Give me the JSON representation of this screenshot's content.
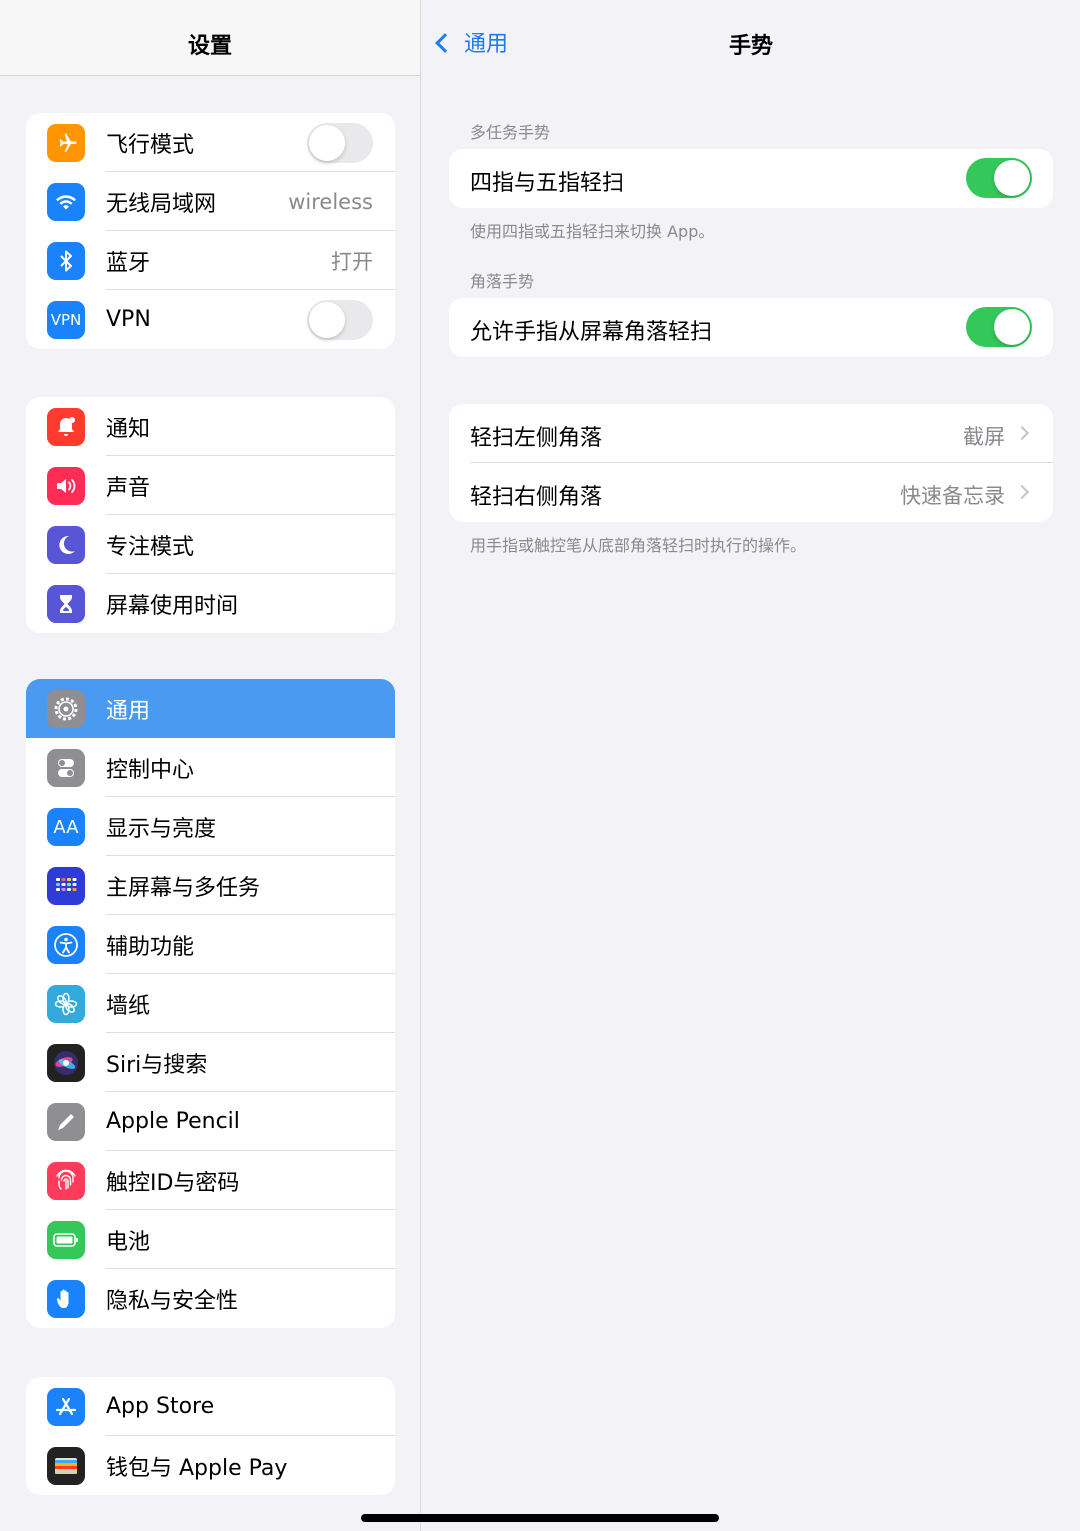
{
  "sidebar": {
    "title": "设置",
    "groups": [
      {
        "items": [
          {
            "label": "飞行模式",
            "icon": "airplane-icon",
            "color": "#ff9500",
            "toggle": false
          },
          {
            "label": "无线局域网",
            "icon": "wifi-icon",
            "color": "#1a82fb",
            "value": "wireless"
          },
          {
            "label": "蓝牙",
            "icon": "bluetooth-icon",
            "color": "#1a82fb",
            "value": "打开"
          },
          {
            "label": "VPN",
            "icon": "vpn-icon",
            "color": "#1a82fb",
            "icon_text": "VPN",
            "toggle": false
          }
        ]
      },
      {
        "items": [
          {
            "label": "通知",
            "icon": "notification-bell-icon",
            "color": "#ff3b30"
          },
          {
            "label": "声音",
            "icon": "speaker-icon",
            "color": "#ff2d55"
          },
          {
            "label": "专注模式",
            "icon": "moon-icon",
            "color": "#5856d6"
          },
          {
            "label": "屏幕使用时间",
            "icon": "hourglass-icon",
            "color": "#5856d6"
          }
        ]
      },
      {
        "items": [
          {
            "label": "通用",
            "icon": "gear-icon",
            "color": "#8e8e93",
            "selected": true
          },
          {
            "label": "控制中心",
            "icon": "control-center-icon",
            "color": "#8e8e93"
          },
          {
            "label": "显示与亮度",
            "icon": "display-aa-icon",
            "color": "#1a82fb",
            "icon_text": "AA"
          },
          {
            "label": "主屏幕与多任务",
            "icon": "home-screen-grid-icon",
            "color": "#2f3bd6"
          },
          {
            "label": "辅助功能",
            "icon": "accessibility-icon",
            "color": "#1a82fb"
          },
          {
            "label": "墙纸",
            "icon": "wallpaper-flower-icon",
            "color": "#34aadc"
          },
          {
            "label": "Siri与搜索",
            "icon": "siri-icon",
            "color": "#222222"
          },
          {
            "label": "Apple Pencil",
            "icon": "pencil-icon",
            "color": "#8e8e93"
          },
          {
            "label": "触控ID与密码",
            "icon": "fingerprint-icon",
            "color": "#ff3b5c"
          },
          {
            "label": "电池",
            "icon": "battery-icon",
            "color": "#34c759"
          },
          {
            "label": "隐私与安全性",
            "icon": "hand-icon",
            "color": "#1a82fb"
          }
        ]
      },
      {
        "items": [
          {
            "label": "App Store",
            "icon": "app-store-icon",
            "color": "#1a82fb"
          },
          {
            "label": "钱包与 Apple Pay",
            "icon": "wallet-icon",
            "color": "#222222"
          }
        ]
      }
    ]
  },
  "detail": {
    "back_label": "通用",
    "title": "手势",
    "sections": [
      {
        "header": "多任务手势",
        "rows": [
          {
            "label": "四指与五指轻扫",
            "toggle": true
          }
        ],
        "footer": "使用四指或五指轻扫来切换 App。"
      },
      {
        "header": "角落手势",
        "rows": [
          {
            "label": "允许手指从屏幕角落轻扫",
            "toggle": true
          }
        ],
        "footer": ""
      },
      {
        "header": "",
        "rows": [
          {
            "label": "轻扫左侧角落",
            "value": "截屏"
          },
          {
            "label": "轻扫右侧角落",
            "value": "快速备忘录"
          }
        ],
        "footer": "用手指或触控笔从底部角落轻扫时执行的操作。"
      }
    ]
  },
  "colors": {
    "accent": "#1d7cf2",
    "switch_on": "#34c759",
    "selected_row": "#4a9af1",
    "background": "#f2f2f7"
  }
}
